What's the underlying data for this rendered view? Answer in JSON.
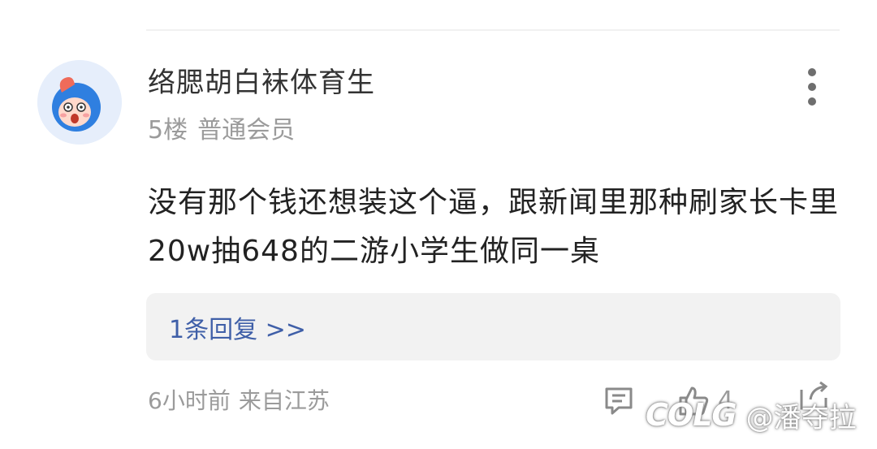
{
  "post": {
    "username": "络腮胡白袜体育生",
    "floor": "5楼",
    "member_level": "普通会员",
    "content": "没有那个钱还想装这个逼，跟新闻里那种刷家长卡里20w抽648的二游小学生做同一桌",
    "reply_label": "1条回复 >>",
    "time": "6小时前",
    "location": "来自江苏",
    "like_count": "4"
  },
  "watermark": {
    "logo": "COLG",
    "handle": "@潘夺拉"
  },
  "icons": {
    "avatar": "cartoon-face-avatar",
    "more": "more-vertical-icon",
    "comment": "comment-icon",
    "like": "thumbs-up-icon",
    "share": "share-icon"
  },
  "colors": {
    "reply_link": "#3f5fa8",
    "meta_text": "#9b9b9b",
    "reply_bg": "#f2f2f2"
  }
}
